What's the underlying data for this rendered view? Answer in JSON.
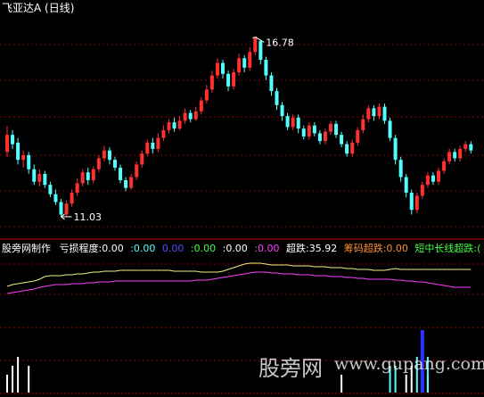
{
  "title": "飞亚达A",
  "period": "(日线)",
  "price_panel": {
    "high_label": "16.78",
    "low_label": "11.03",
    "price_range": [
      10.6,
      17.45
    ],
    "candles": [
      [
        13.1,
        13.65,
        13.92,
        12.95
      ],
      [
        13.65,
        13.35,
        13.8,
        13.2
      ],
      [
        13.4,
        12.85,
        13.55,
        12.7
      ],
      [
        12.85,
        13.0,
        13.15,
        12.6
      ],
      [
        13.0,
        12.55,
        13.1,
        12.4
      ],
      [
        12.55,
        12.15,
        12.7,
        12.05
      ],
      [
        12.15,
        12.4,
        12.55,
        12.0
      ],
      [
        12.4,
        12.05,
        12.5,
        11.95
      ],
      [
        12.05,
        11.75,
        12.15,
        11.65
      ],
      [
        11.75,
        11.5,
        11.9,
        11.4
      ],
      [
        11.5,
        11.1,
        11.6,
        11.03
      ],
      [
        11.1,
        11.45,
        11.55,
        11.05
      ],
      [
        11.45,
        11.8,
        11.9,
        11.35
      ],
      [
        11.8,
        12.1,
        12.25,
        11.7
      ],
      [
        12.1,
        12.45,
        12.55,
        12.0
      ],
      [
        12.45,
        12.2,
        12.6,
        12.05
      ],
      [
        12.2,
        12.55,
        12.65,
        12.1
      ],
      [
        12.55,
        12.9,
        13.0,
        12.45
      ],
      [
        12.9,
        13.15,
        13.3,
        12.8
      ],
      [
        13.15,
        12.85,
        13.25,
        12.7
      ],
      [
        12.85,
        12.6,
        12.95,
        12.5
      ],
      [
        12.6,
        12.2,
        12.7,
        12.1
      ],
      [
        12.2,
        11.95,
        12.3,
        11.85
      ],
      [
        11.95,
        12.3,
        12.4,
        11.9
      ],
      [
        12.3,
        12.7,
        12.8,
        12.2
      ],
      [
        12.7,
        13.05,
        13.15,
        12.6
      ],
      [
        13.05,
        13.4,
        13.5,
        12.95
      ],
      [
        13.4,
        13.2,
        13.55,
        13.05
      ],
      [
        13.2,
        13.55,
        13.7,
        13.1
      ],
      [
        13.55,
        13.8,
        13.95,
        13.45
      ],
      [
        13.8,
        14.05,
        14.15,
        13.7
      ],
      [
        14.05,
        13.85,
        14.2,
        13.75
      ],
      [
        13.85,
        14.1,
        14.25,
        13.8
      ],
      [
        14.1,
        14.35,
        14.5,
        14.0
      ],
      [
        14.35,
        14.15,
        14.45,
        14.05
      ],
      [
        14.15,
        14.4,
        14.55,
        14.1
      ],
      [
        14.4,
        14.75,
        14.85,
        14.3
      ],
      [
        14.75,
        15.1,
        15.25,
        14.65
      ],
      [
        15.1,
        15.55,
        15.7,
        15.0
      ],
      [
        15.55,
        15.95,
        16.1,
        15.45
      ],
      [
        15.95,
        15.6,
        16.05,
        15.45
      ],
      [
        15.6,
        15.2,
        15.7,
        15.05
      ],
      [
        15.2,
        15.65,
        15.75,
        15.1
      ],
      [
        15.65,
        16.1,
        16.25,
        15.55
      ],
      [
        16.1,
        15.8,
        16.2,
        15.65
      ],
      [
        15.8,
        16.3,
        16.45,
        15.7
      ],
      [
        16.3,
        16.78,
        16.78,
        16.2
      ],
      [
        16.65,
        16.05,
        16.7,
        15.9
      ],
      [
        16.05,
        15.55,
        16.15,
        15.4
      ],
      [
        15.55,
        15.05,
        15.65,
        14.9
      ],
      [
        15.05,
        14.6,
        15.15,
        14.45
      ],
      [
        14.6,
        14.25,
        14.7,
        14.1
      ],
      [
        14.25,
        13.9,
        14.35,
        13.8
      ],
      [
        13.9,
        14.2,
        14.3,
        13.8
      ],
      [
        14.2,
        13.85,
        14.3,
        13.7
      ],
      [
        13.85,
        13.6,
        13.95,
        13.5
      ],
      [
        13.6,
        13.95,
        14.05,
        13.5
      ],
      [
        13.95,
        13.7,
        14.05,
        13.6
      ],
      [
        13.7,
        13.45,
        13.8,
        13.35
      ],
      [
        13.45,
        13.75,
        13.85,
        13.35
      ],
      [
        13.75,
        14.0,
        14.1,
        13.65
      ],
      [
        14.0,
        13.65,
        14.1,
        13.55
      ],
      [
        13.65,
        13.35,
        13.75,
        13.25
      ],
      [
        13.35,
        13.05,
        13.45,
        12.95
      ],
      [
        13.05,
        13.4,
        13.5,
        12.95
      ],
      [
        13.4,
        13.8,
        13.9,
        13.3
      ],
      [
        13.8,
        14.15,
        14.3,
        13.7
      ],
      [
        14.15,
        14.5,
        14.6,
        14.05
      ],
      [
        14.5,
        14.25,
        14.6,
        14.1
      ],
      [
        14.25,
        14.55,
        14.65,
        14.15
      ],
      [
        14.55,
        14.1,
        14.65,
        14.0
      ],
      [
        14.1,
        13.55,
        14.2,
        13.45
      ],
      [
        13.55,
        12.85,
        13.65,
        12.7
      ],
      [
        12.85,
        12.3,
        12.95,
        12.15
      ],
      [
        12.3,
        11.8,
        12.4,
        11.65
      ],
      [
        11.8,
        11.25,
        11.9,
        11.1
      ],
      [
        11.25,
        11.7,
        11.8,
        11.15
      ],
      [
        11.7,
        12.05,
        12.15,
        11.6
      ],
      [
        12.05,
        12.35,
        12.45,
        11.95
      ],
      [
        12.35,
        12.15,
        12.45,
        12.05
      ],
      [
        12.15,
        12.5,
        12.6,
        12.05
      ],
      [
        12.5,
        12.8,
        12.9,
        12.4
      ],
      [
        12.8,
        13.1,
        13.2,
        12.7
      ],
      [
        13.1,
        12.9,
        13.2,
        12.8
      ],
      [
        12.9,
        13.2,
        13.3,
        12.8
      ],
      [
        13.2,
        13.35,
        13.45,
        13.1
      ],
      [
        13.35,
        13.15,
        13.45,
        13.05
      ]
    ]
  },
  "indicator_header": {
    "name": "股旁网制作",
    "loss_label": "亏损程度",
    "v1": ":0.00",
    "v2": ":0.00",
    "v3": "0.00",
    "v4": ":0.00",
    "v5": ":0.00",
    "v6": ":0.00",
    "chao_die_label": "超跌",
    "chao_die_value": ":35.92",
    "chip_label": "筹码超跌",
    "chip_value": ":0.00",
    "long_short_label": "短中长线超跌",
    "long_short_value": ":("
  },
  "indicator_panel": {
    "yellow_line": [
      36,
      34,
      33,
      32,
      31,
      30,
      28,
      25,
      24,
      24,
      24,
      23,
      23,
      22,
      22,
      21,
      20,
      20,
      19,
      19,
      19,
      18,
      18,
      18,
      18,
      18,
      18,
      18,
      18,
      18,
      18,
      19,
      19,
      19,
      19,
      19,
      20,
      20,
      20,
      20,
      19,
      17,
      15,
      13,
      11,
      10,
      10,
      10,
      11,
      12,
      12,
      12,
      12,
      13,
      13,
      13,
      13,
      14,
      14,
      14,
      15,
      15,
      15,
      16,
      16,
      17,
      17,
      17,
      18,
      18,
      18,
      17,
      16,
      17,
      17,
      17,
      17,
      17,
      17,
      17,
      17,
      17,
      17,
      17,
      17,
      17,
      17
    ],
    "magenta_line": [
      44,
      43,
      42,
      41,
      40,
      39,
      37,
      36,
      35,
      34,
      34,
      34,
      33,
      33,
      33,
      32,
      32,
      31,
      31,
      31,
      30,
      30,
      30,
      30,
      30,
      30,
      30,
      30,
      30,
      30,
      30,
      30,
      30,
      30,
      30,
      29,
      29,
      29,
      28,
      27,
      26,
      25,
      24,
      23,
      22,
      21,
      20,
      20,
      20,
      21,
      21,
      22,
      22,
      22,
      23,
      23,
      23,
      24,
      24,
      24,
      25,
      25,
      25,
      26,
      26,
      27,
      27,
      28,
      28,
      28,
      28,
      28,
      29,
      29,
      30,
      30,
      31,
      31,
      32,
      33,
      34,
      35,
      36,
      37,
      37,
      37,
      37
    ],
    "bars_white": [
      2,
      3,
      4,
      0,
      3,
      0,
      0,
      0,
      0,
      0,
      0,
      0,
      0,
      0,
      0,
      0,
      0,
      0,
      0,
      0,
      0,
      0,
      0,
      0,
      0,
      0,
      0,
      0,
      0,
      0,
      0,
      0,
      0,
      0,
      0,
      0,
      0,
      0,
      0,
      0,
      0,
      0,
      0,
      0,
      0,
      0,
      0,
      0,
      0,
      0,
      0,
      0,
      0,
      0,
      0,
      0,
      0,
      0,
      0,
      0,
      0,
      0,
      2,
      0,
      0,
      0,
      0,
      0,
      0,
      0,
      0,
      0,
      0,
      0,
      2,
      3,
      0,
      0,
      2,
      0,
      0,
      0,
      0,
      0,
      0,
      0,
      0
    ],
    "bars_cyan": [
      0,
      0,
      0,
      0,
      0,
      0,
      0,
      0,
      0,
      0,
      0,
      0,
      0,
      0,
      0,
      0,
      0,
      0,
      0,
      0,
      0,
      0,
      0,
      0,
      0,
      0,
      0,
      0,
      0,
      0,
      0,
      0,
      0,
      0,
      0,
      0,
      0,
      0,
      0,
      0,
      0,
      0,
      0,
      0,
      0,
      0,
      0,
      0,
      0,
      0,
      0,
      0,
      0,
      0,
      0,
      0,
      0,
      0,
      0,
      0,
      0,
      0,
      0,
      0,
      0,
      0,
      0,
      0,
      0,
      0,
      0,
      3,
      3,
      0,
      0,
      0,
      4,
      4,
      4,
      0,
      0,
      0,
      0,
      0,
      0,
      0,
      0
    ],
    "bars_blue": [
      0,
      0,
      0,
      0,
      0,
      0,
      0,
      0,
      0,
      0,
      0,
      0,
      0,
      0,
      0,
      0,
      0,
      0,
      0,
      0,
      0,
      0,
      0,
      0,
      0,
      0,
      0,
      0,
      0,
      0,
      0,
      0,
      0,
      0,
      0,
      0,
      0,
      0,
      0,
      0,
      0,
      0,
      0,
      0,
      0,
      0,
      0,
      0,
      0,
      0,
      0,
      0,
      0,
      0,
      0,
      0,
      0,
      0,
      0,
      0,
      0,
      0,
      0,
      0,
      0,
      0,
      0,
      0,
      0,
      0,
      0,
      0,
      0,
      0,
      0,
      0,
      0,
      7,
      0,
      0,
      0,
      0,
      0,
      0,
      0,
      0,
      0
    ]
  },
  "watermark": {
    "cn": "股旁网",
    "en": "www.gupang.com"
  },
  "colors": {
    "up": "#ff3030",
    "down": "#54ffff",
    "grid": "#8b0000",
    "yellow": "#f0f080",
    "magenta": "#ff40ff",
    "blue": "#3030ff"
  }
}
